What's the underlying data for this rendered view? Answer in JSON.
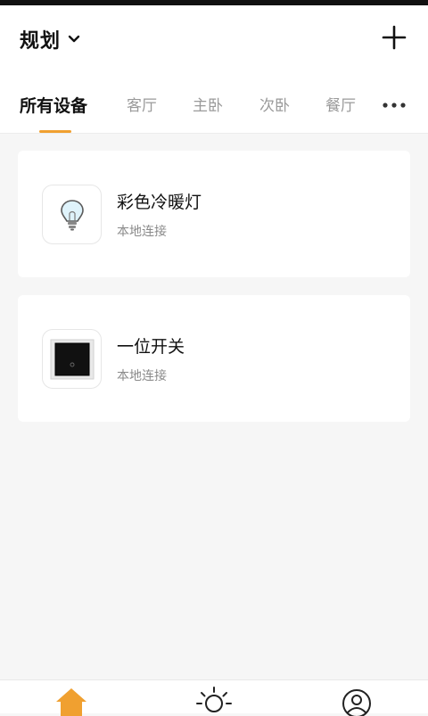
{
  "header": {
    "home_name": "规划",
    "icons": {
      "dropdown": "chevron-down-icon",
      "add": "plus-icon",
      "more": "more-dots-icon"
    }
  },
  "tabs": [
    {
      "label": "所有设备",
      "active": true
    },
    {
      "label": "客厅",
      "active": false
    },
    {
      "label": "主卧",
      "active": false
    },
    {
      "label": "次卧",
      "active": false
    },
    {
      "label": "餐厅",
      "active": false
    }
  ],
  "devices": [
    {
      "name": "彩色冷暖灯",
      "status": "本地连接",
      "icon": "light-bulb-icon"
    },
    {
      "name": "一位开关",
      "status": "本地连接",
      "icon": "wall-switch-icon"
    }
  ],
  "bottom_nav": [
    {
      "icon": "home-icon",
      "active": true
    },
    {
      "icon": "sun-icon",
      "active": false
    },
    {
      "icon": "user-profile-icon",
      "active": false
    }
  ],
  "colors": {
    "accent": "#f0a030",
    "background": "#f6f6f6",
    "text_primary": "#111111",
    "text_secondary": "#8a8a8a"
  }
}
